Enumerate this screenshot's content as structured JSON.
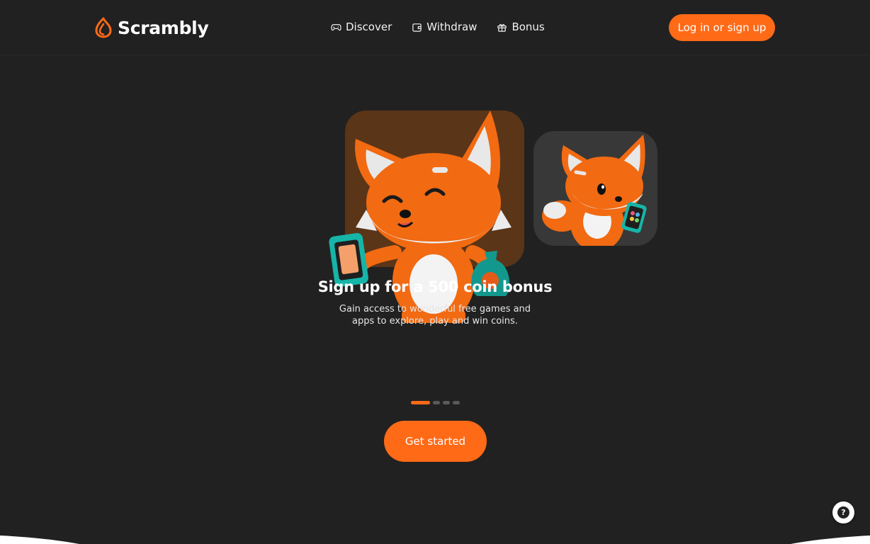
{
  "header": {
    "brand": "Scrambly",
    "nav": [
      {
        "label": "Discover",
        "icon": "gamepad-icon"
      },
      {
        "label": "Withdraw",
        "icon": "wallet-icon"
      },
      {
        "label": "Bonus",
        "icon": "gift-icon"
      }
    ],
    "login_label": "Log in or sign up"
  },
  "hero": {
    "title": "Sign up for a 500 coin bonus",
    "subtitle": "Gain access to wonderful free games and apps to explore, play and win coins.",
    "slides_total": 4,
    "active_slide": 1,
    "cta_label": "Get started"
  },
  "help": {
    "label": "?"
  },
  "colors": {
    "background": "#212121",
    "accent": "#ff6a17",
    "card_main": "#5a3518",
    "card_side": "#383838",
    "dot_inactive": "#5a5a5a"
  }
}
